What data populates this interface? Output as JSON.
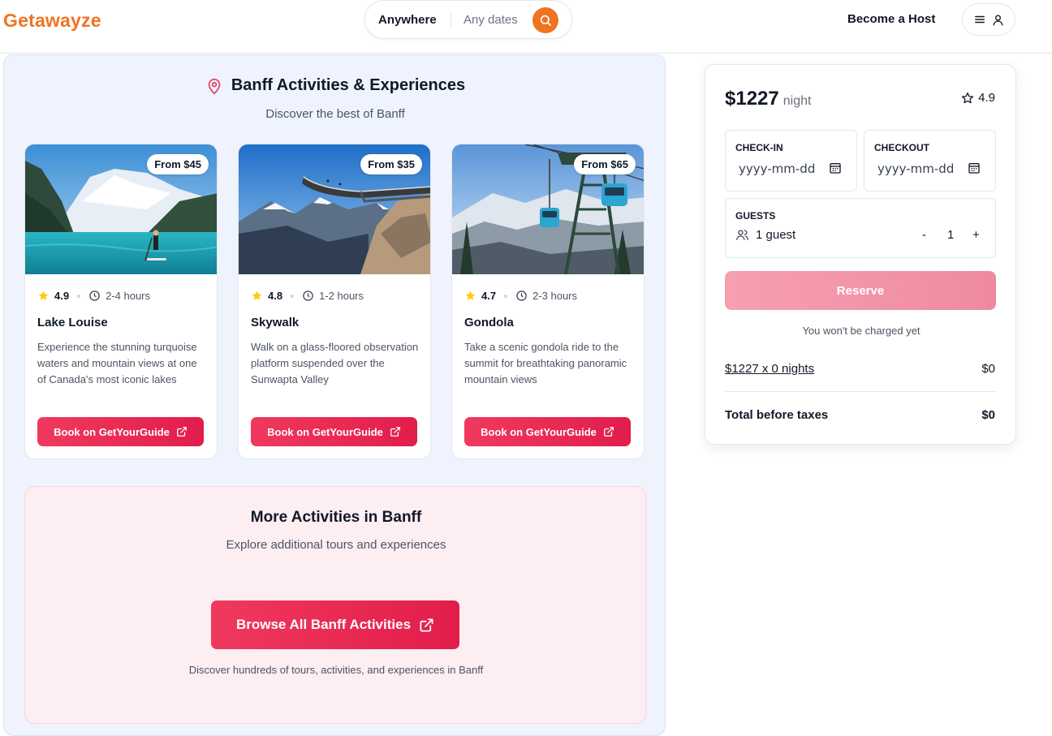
{
  "header": {
    "logo": "Getawayze",
    "search_location": "Anywhere",
    "search_dates": "Any dates",
    "host_link": "Become a Host"
  },
  "activities": {
    "title": "Banff Activities & Experiences",
    "subtitle": "Discover the best of Banff",
    "cards": [
      {
        "price": "From $45",
        "rating": "4.9",
        "duration": "2-4 hours",
        "title": "Lake Louise",
        "description": "Experience the stunning turquoise waters and mountain views at one of Canada's most iconic lakes",
        "button": "Book on GetYourGuide"
      },
      {
        "price": "From $35",
        "rating": "4.8",
        "duration": "1-2 hours",
        "title": "Skywalk",
        "description": "Walk on a glass-floored observation platform suspended over the Sunwapta Valley",
        "button": "Book on GetYourGuide"
      },
      {
        "price": "From $65",
        "rating": "4.7",
        "duration": "2-3 hours",
        "title": "Gondola",
        "description": "Take a scenic gondola ride to the summit for breathtaking panoramic mountain views",
        "button": "Book on GetYourGuide"
      }
    ]
  },
  "more": {
    "title": "More Activities in Banff",
    "subtitle": "Explore additional tours and experiences",
    "button": "Browse All Banff Activities",
    "note": "Discover hundreds of tours, activities, and experiences in Banff"
  },
  "booking": {
    "price": "$1227",
    "price_unit": "night",
    "rating": "4.9",
    "checkin_label": "CHECK-IN",
    "checkin_placeholder": "yyyy-mm-dd",
    "checkout_label": "CHECKOUT",
    "checkout_placeholder": "yyyy-mm-dd",
    "guests_label": "GUESTS",
    "guests_text": "1 guest",
    "guest_minus": "-",
    "guest_count": "1",
    "guest_plus": "+",
    "reserve": "Reserve",
    "no_charge": "You won't be charged yet",
    "calc_label": "$1227 x 0 nights",
    "calc_value": "$0",
    "total_label": "Total before taxes",
    "total_value": "$0"
  },
  "colors": {
    "brand": "#f0731f",
    "accent": "#e21d4b",
    "reserve_disabled": "#f29aac",
    "panel_bg": "#eef3fd",
    "more_bg": "#fdeef2"
  },
  "icons": [
    "search-icon",
    "menu-icon",
    "user-icon",
    "map-pin-icon",
    "star-icon",
    "clock-icon",
    "external-link-icon",
    "calendar-icon",
    "users-icon"
  ]
}
